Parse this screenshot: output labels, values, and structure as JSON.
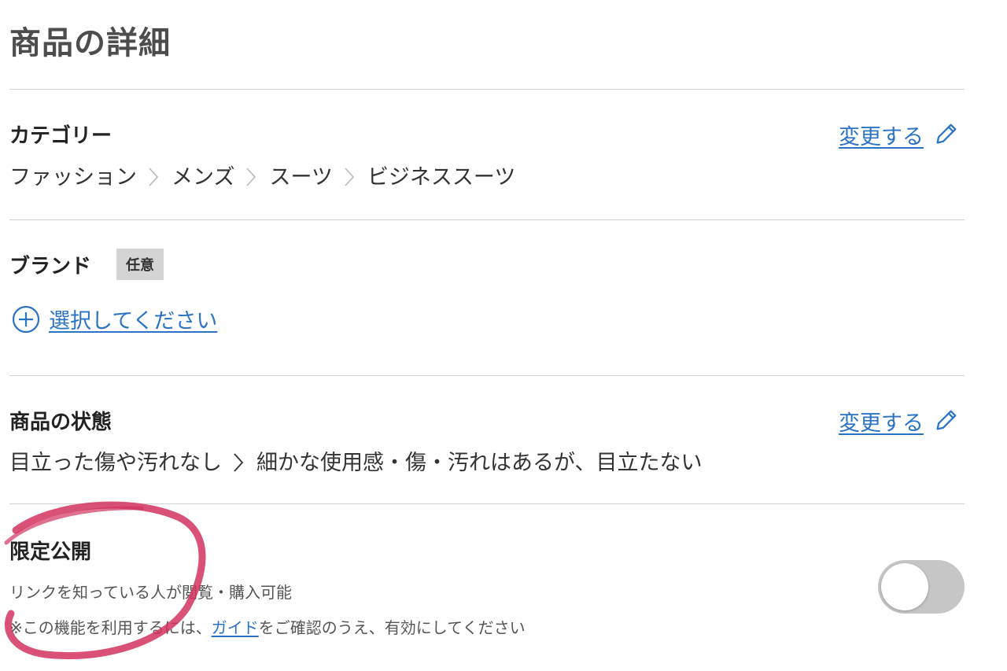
{
  "page": {
    "title": "商品の詳細"
  },
  "category": {
    "heading": "カテゴリー",
    "change_label": "変更する",
    "path": [
      "ファッション",
      "メンズ",
      "スーツ",
      "ビジネススーツ"
    ]
  },
  "brand": {
    "heading": "ブランド",
    "badge": "任意",
    "select_label": "選択してください"
  },
  "condition": {
    "heading": "商品の状態",
    "change_label": "変更する",
    "before": "目立った傷や汚れなし",
    "after": "細かな使用感・傷・汚れはあるが、目立たない"
  },
  "limited": {
    "heading": "限定公開",
    "description": "リンクを知っている人が閲覧・購入可能",
    "note_prefix": "※この機能を利用するには、",
    "note_link": "ガイド",
    "note_suffix": "をご確認のうえ、有効にしてください",
    "toggle_on": false
  },
  "colors": {
    "link": "#2b73c4",
    "annotation": "#d2335f",
    "toggle_off": "#c6c6c6"
  },
  "icons": {
    "pencil": "pencil-icon",
    "plus": "plus-circle-icon",
    "chevron": "chevron-right-icon"
  }
}
